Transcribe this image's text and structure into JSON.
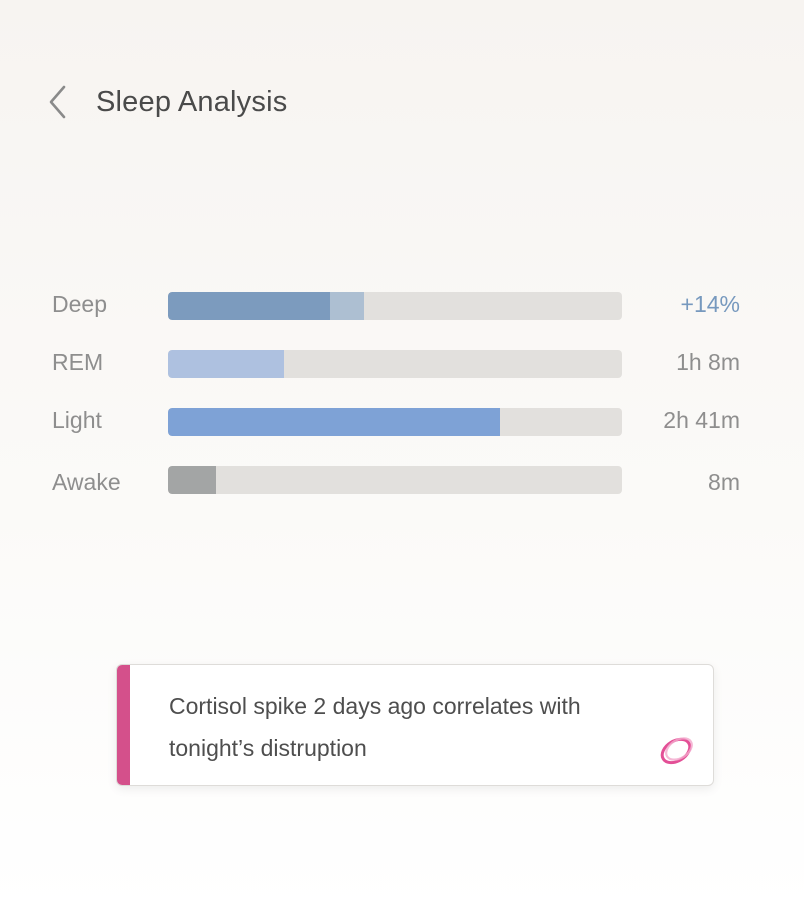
{
  "header": {
    "title": "Sleep Analysis",
    "back_icon": "chevron-left-icon"
  },
  "sleep_stages": [
    {
      "label": "Deep",
      "value": "+14%",
      "value_color": "#7799be",
      "fill_fraction": 0.357,
      "extra_fraction": 0.075,
      "fill_color": "#7c9bbe",
      "extra_color": "#adbfd2"
    },
    {
      "label": "REM",
      "value": "1h 8m",
      "value_color": "#8e8e8e",
      "fill_fraction": 0.255,
      "fill_color": "#aec1e0"
    },
    {
      "label": "Light",
      "value": "2h 41m",
      "value_color": "#8e8e8e",
      "fill_fraction": 0.731,
      "fill_color": "#7ea2d6"
    },
    {
      "label": "Awake",
      "value": "8m",
      "value_color": "#8e8e8e",
      "fill_fraction": 0.106,
      "fill_color": "#a3a5a5"
    }
  ],
  "insight": {
    "text": "Cortisol spike 2 days ago correlates with tonight’s distruption",
    "accent_color": "#d4508b",
    "icon": "ring-icon"
  },
  "colors": {
    "track": "#e2e0dd",
    "title_text": "#4a4a4a",
    "label_text": "#8e8e8e"
  }
}
